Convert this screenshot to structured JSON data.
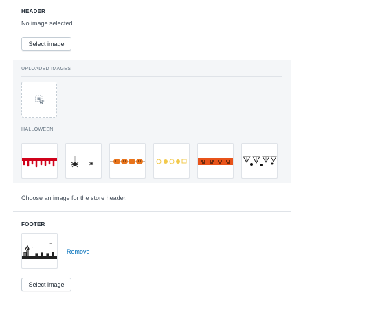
{
  "header": {
    "title": "HEADER",
    "status": "No image selected",
    "select_label": "Select image",
    "help_text": "Choose an image for the store header."
  },
  "uploaded": {
    "label": "UPLOADED IMAGES",
    "upload_icon": "upload-image-icon"
  },
  "halloween": {
    "label": "HALLOWEEN",
    "thumbnails": [
      {
        "name": "blood-drip-border",
        "accent": "#d0021b"
      },
      {
        "name": "spiders-border",
        "accent": "#222222"
      },
      {
        "name": "pumpkins-border",
        "accent": "#e8731a"
      },
      {
        "name": "smiley-pumpkins-border",
        "accent": "#f2c94c"
      },
      {
        "name": "orange-jack-o-lantern-banner",
        "accent": "#e8531a"
      },
      {
        "name": "spider-webs-border",
        "accent": "#111111"
      }
    ]
  },
  "footer": {
    "title": "FOOTER",
    "thumbnail": "haunted-graveyard-silhouette",
    "remove_label": "Remove",
    "select_label": "Select image"
  },
  "colors": {
    "panel_bg": "#f4f6f8",
    "link": "#006fbb",
    "border": "#c4cdd5"
  }
}
